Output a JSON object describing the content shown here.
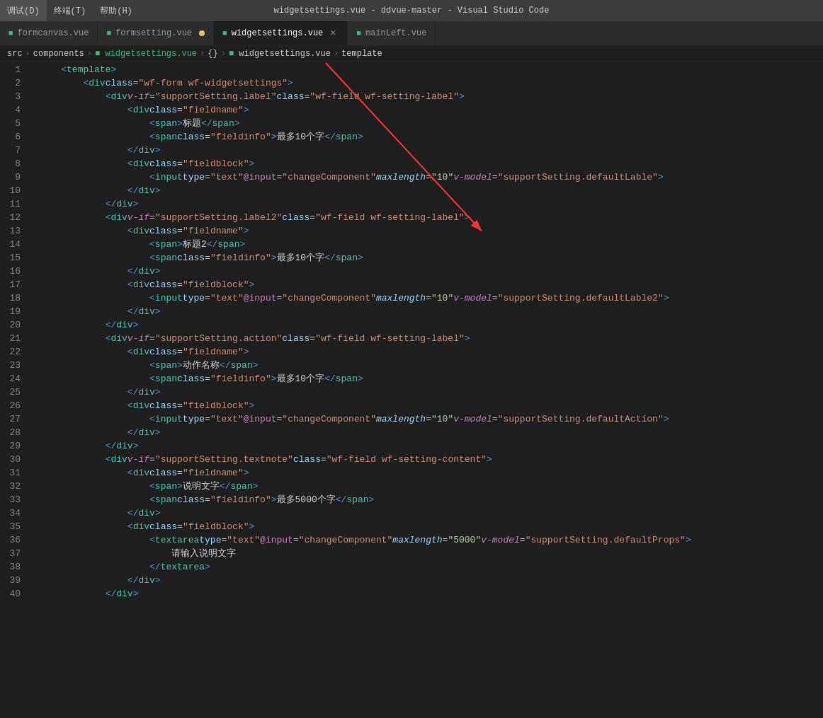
{
  "titleBar": {
    "menu": [
      "调试(D)",
      "终端(T)",
      "帮助(H)"
    ],
    "title": "widgetsettings.vue - ddvue-master - Visual Studio Code"
  },
  "tabs": [
    {
      "id": "formcanvas",
      "label": "formcanvas.vue",
      "icon": "vue",
      "active": false,
      "modified": false,
      "closeable": false
    },
    {
      "id": "formsetting",
      "label": "formsetting.vue",
      "icon": "vue",
      "active": false,
      "modified": true,
      "closeable": true
    },
    {
      "id": "widgetsettings",
      "label": "widgetsettings.vue",
      "icon": "vue",
      "active": true,
      "modified": false,
      "closeable": true
    },
    {
      "id": "mainleft",
      "label": "mainLeft.vue",
      "icon": "vue",
      "active": false,
      "modified": false,
      "closeable": false
    }
  ],
  "breadcrumb": {
    "items": [
      "src",
      "components",
      "widgetsettings.vue",
      "{}",
      "widgetsettings.vue",
      "template"
    ]
  },
  "lines": [
    {
      "num": 1,
      "indent": 1,
      "content": "<template>"
    },
    {
      "num": 2,
      "indent": 2,
      "content": "<div class=\"wf-form wf-widgetsettings\">"
    },
    {
      "num": 3,
      "indent": 3,
      "content": "<div v-if=\"supportSetting.label\" class=\"wf-field wf-setting-label\">"
    },
    {
      "num": 4,
      "indent": 4,
      "content": "<div class=\"fieldname\">"
    },
    {
      "num": 5,
      "indent": 5,
      "content": "<span>标题</span>"
    },
    {
      "num": 6,
      "indent": 5,
      "content": "<span class=\"fieldinfo\">最多10个字</span>"
    },
    {
      "num": 7,
      "indent": 4,
      "content": "</div>"
    },
    {
      "num": 8,
      "indent": 4,
      "content": "<div class=\"fieldblock\">"
    },
    {
      "num": 9,
      "indent": 5,
      "content": "<input type=\"text\" @input=\"changeComponent\" maxlength=\"10\" v-model=\"supportSetting.defaultLable\">"
    },
    {
      "num": 10,
      "indent": 4,
      "content": "</div>"
    },
    {
      "num": 11,
      "indent": 3,
      "content": "</div>"
    },
    {
      "num": 12,
      "indent": 3,
      "content": "<div v-if=\"supportSetting.label2\" class=\"wf-field wf-setting-label\">"
    },
    {
      "num": 13,
      "indent": 4,
      "content": "<div class=\"fieldname\">"
    },
    {
      "num": 14,
      "indent": 5,
      "content": "<span>标题2</span>"
    },
    {
      "num": 15,
      "indent": 5,
      "content": "<span class=\"fieldinfo\">最多10个字</span>"
    },
    {
      "num": 16,
      "indent": 4,
      "content": "</div>"
    },
    {
      "num": 17,
      "indent": 4,
      "content": "<div class=\"fieldblock\">"
    },
    {
      "num": 18,
      "indent": 5,
      "content": "<input type=\"text\" @input=\"changeComponent\" maxlength=\"10\" v-model=\"supportSetting.defaultLable2\">"
    },
    {
      "num": 19,
      "indent": 4,
      "content": "</div>"
    },
    {
      "num": 20,
      "indent": 3,
      "content": "</div>"
    },
    {
      "num": 21,
      "indent": 3,
      "content": "<div v-if=\"supportSetting.action\" class=\"wf-field wf-setting-label\">"
    },
    {
      "num": 22,
      "indent": 4,
      "content": "<div class=\"fieldname\">"
    },
    {
      "num": 23,
      "indent": 5,
      "content": "<span>动作名称</span>"
    },
    {
      "num": 24,
      "indent": 5,
      "content": "<span class=\"fieldinfo\">最多10个字</span>"
    },
    {
      "num": 25,
      "indent": 4,
      "content": "</div>"
    },
    {
      "num": 26,
      "indent": 4,
      "content": "<div class=\"fieldblock\">"
    },
    {
      "num": 27,
      "indent": 5,
      "content": "<input type=\"text\" @input=\"changeComponent\" maxlength=\"10\" v-model=\"supportSetting.defaultAction\">"
    },
    {
      "num": 28,
      "indent": 4,
      "content": "</div>"
    },
    {
      "num": 29,
      "indent": 3,
      "content": "</div>"
    },
    {
      "num": 30,
      "indent": 3,
      "content": "<div v-if=\"supportSetting.textnote\" class=\"wf-field wf-setting-content\">"
    },
    {
      "num": 31,
      "indent": 4,
      "content": "<div class=\"fieldname\">"
    },
    {
      "num": 32,
      "indent": 5,
      "content": "<span>说明文字</span>"
    },
    {
      "num": 33,
      "indent": 5,
      "content": "<span class=\"fieldinfo\">最多5000个字</span>"
    },
    {
      "num": 34,
      "indent": 4,
      "content": "</div>"
    },
    {
      "num": 35,
      "indent": 4,
      "content": "<div class=\"fieldblock\">"
    },
    {
      "num": 36,
      "indent": 5,
      "content": "<textarea type=\"text\" @input=\"changeComponent\" maxlength=\"5000\" v-model=\"supportSetting.defaultProps\">"
    },
    {
      "num": 37,
      "indent": 6,
      "content": "请输入说明文字"
    },
    {
      "num": 38,
      "indent": 5,
      "content": "</textarea>"
    },
    {
      "num": 39,
      "indent": 4,
      "content": "</div>"
    },
    {
      "num": 40,
      "indent": 3,
      "content": "</div>"
    }
  ]
}
